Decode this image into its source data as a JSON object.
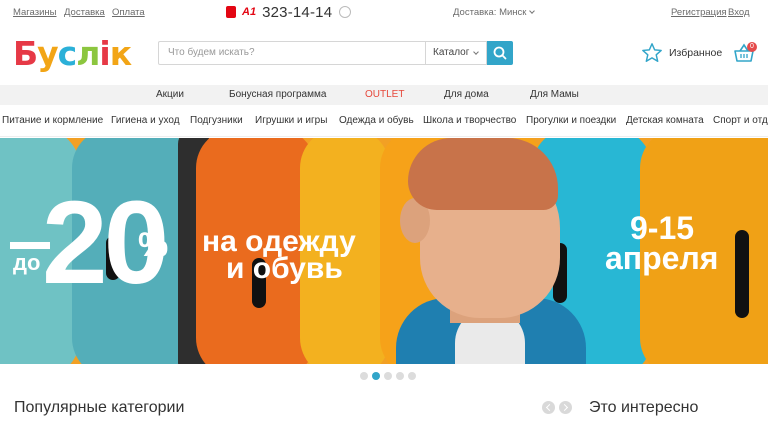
{
  "topbar": {
    "links": [
      "Магазины",
      "Доставка",
      "Оплата"
    ],
    "phone_operator": "A1",
    "phone": "323-14-14",
    "delivery_label": "Доставка:",
    "delivery_city": "Минск",
    "register": "Регистрация",
    "login": "Вход"
  },
  "header": {
    "logo_letters": [
      "Б",
      "у",
      "с",
      "л",
      "і",
      "к"
    ],
    "logo_colors": [
      "#e63946",
      "#f2a516",
      "#2bb0d8",
      "#8cc63f",
      "#e63946",
      "#f2a516"
    ],
    "search_placeholder": "Что будем искать?",
    "catalog_label": "Каталог",
    "favorites": "Избранное",
    "cart_count": "0"
  },
  "promo_nav": [
    "Акции",
    "Бонусная программа",
    "OUTLET",
    "Для дома",
    "Для Мамы"
  ],
  "cat_nav": [
    "Питание и кормление",
    "Гигиена и уход",
    "Подгузники",
    "Игрушки и игры",
    "Одежда и обувь",
    "Школа и творчество",
    "Прогулки и поездки",
    "Детская комната",
    "Спорт и отдых"
  ],
  "banner": {
    "prefix": "до",
    "discount": "20",
    "percent": "%",
    "line1": "на одежду",
    "line2": "и обувь",
    "dates": "9-15",
    "month": "апреля"
  },
  "carousel": {
    "count": 5,
    "active_index": 1
  },
  "sections": {
    "popular": "Популярные категории",
    "interesting": "Это интересно"
  },
  "colors": {
    "accent": "#32a5c9",
    "outlet": "#e6483b"
  }
}
